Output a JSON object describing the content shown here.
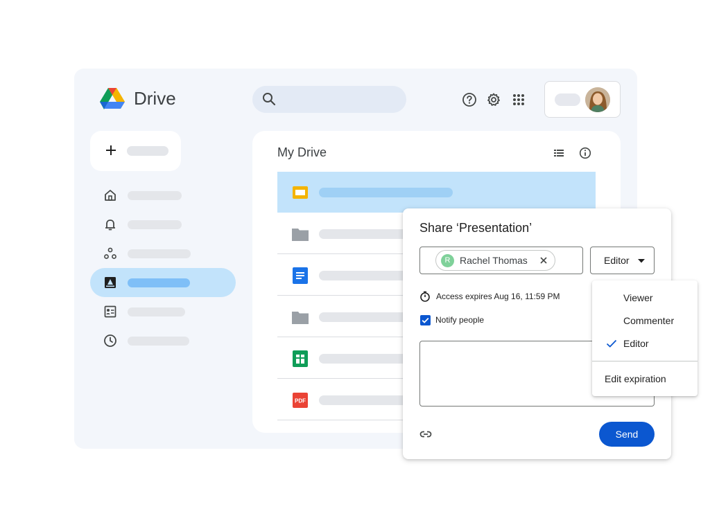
{
  "app": {
    "name": "Drive",
    "search_icon": "search-icon",
    "header_icons": [
      "help-icon",
      "settings-icon",
      "apps-grid-icon"
    ]
  },
  "sidebar": {
    "new_button_icon": "plus-icon",
    "items": [
      {
        "icon": "home-icon",
        "active": false
      },
      {
        "icon": "notification-bell-icon",
        "active": false
      },
      {
        "icon": "shared-people-icon",
        "active": false
      },
      {
        "icon": "my-drive-icon",
        "active": true
      },
      {
        "icon": "contacts-icon",
        "active": false
      },
      {
        "icon": "recent-clock-icon",
        "active": false
      }
    ]
  },
  "main": {
    "title": "My Drive",
    "view_icon": "list-view-icon",
    "info_icon": "info-icon",
    "files": [
      {
        "icon": "slides-icon",
        "selected": true
      },
      {
        "icon": "folder-icon",
        "selected": false
      },
      {
        "icon": "docs-icon",
        "selected": false
      },
      {
        "icon": "folder-icon",
        "selected": false
      },
      {
        "icon": "sheets-icon",
        "selected": false
      },
      {
        "icon": "pdf-icon",
        "selected": false,
        "badge": "PDF"
      }
    ]
  },
  "share_dialog": {
    "title": "Share ‘Presentation’",
    "person": {
      "initial": "R",
      "name": "Rachel Thomas"
    },
    "role": "Editor",
    "access_expires": "Access expires Aug 16, 11:59 PM",
    "notify_label": "Notify people",
    "notify_checked": true,
    "message_value": "",
    "send_label": "Send",
    "role_menu": {
      "options": [
        "Viewer",
        "Commenter",
        "Editor"
      ],
      "selected": "Editor",
      "extra": "Edit expiration"
    }
  },
  "colors": {
    "accent": "#0b57d0",
    "selection": "#c2e3fb",
    "window_bg": "#f3f6fb",
    "slides_yellow": "#f4b400",
    "docs_blue": "#1a73e8",
    "sheets_green": "#0f9d58",
    "pdf_red": "#ea4335"
  }
}
